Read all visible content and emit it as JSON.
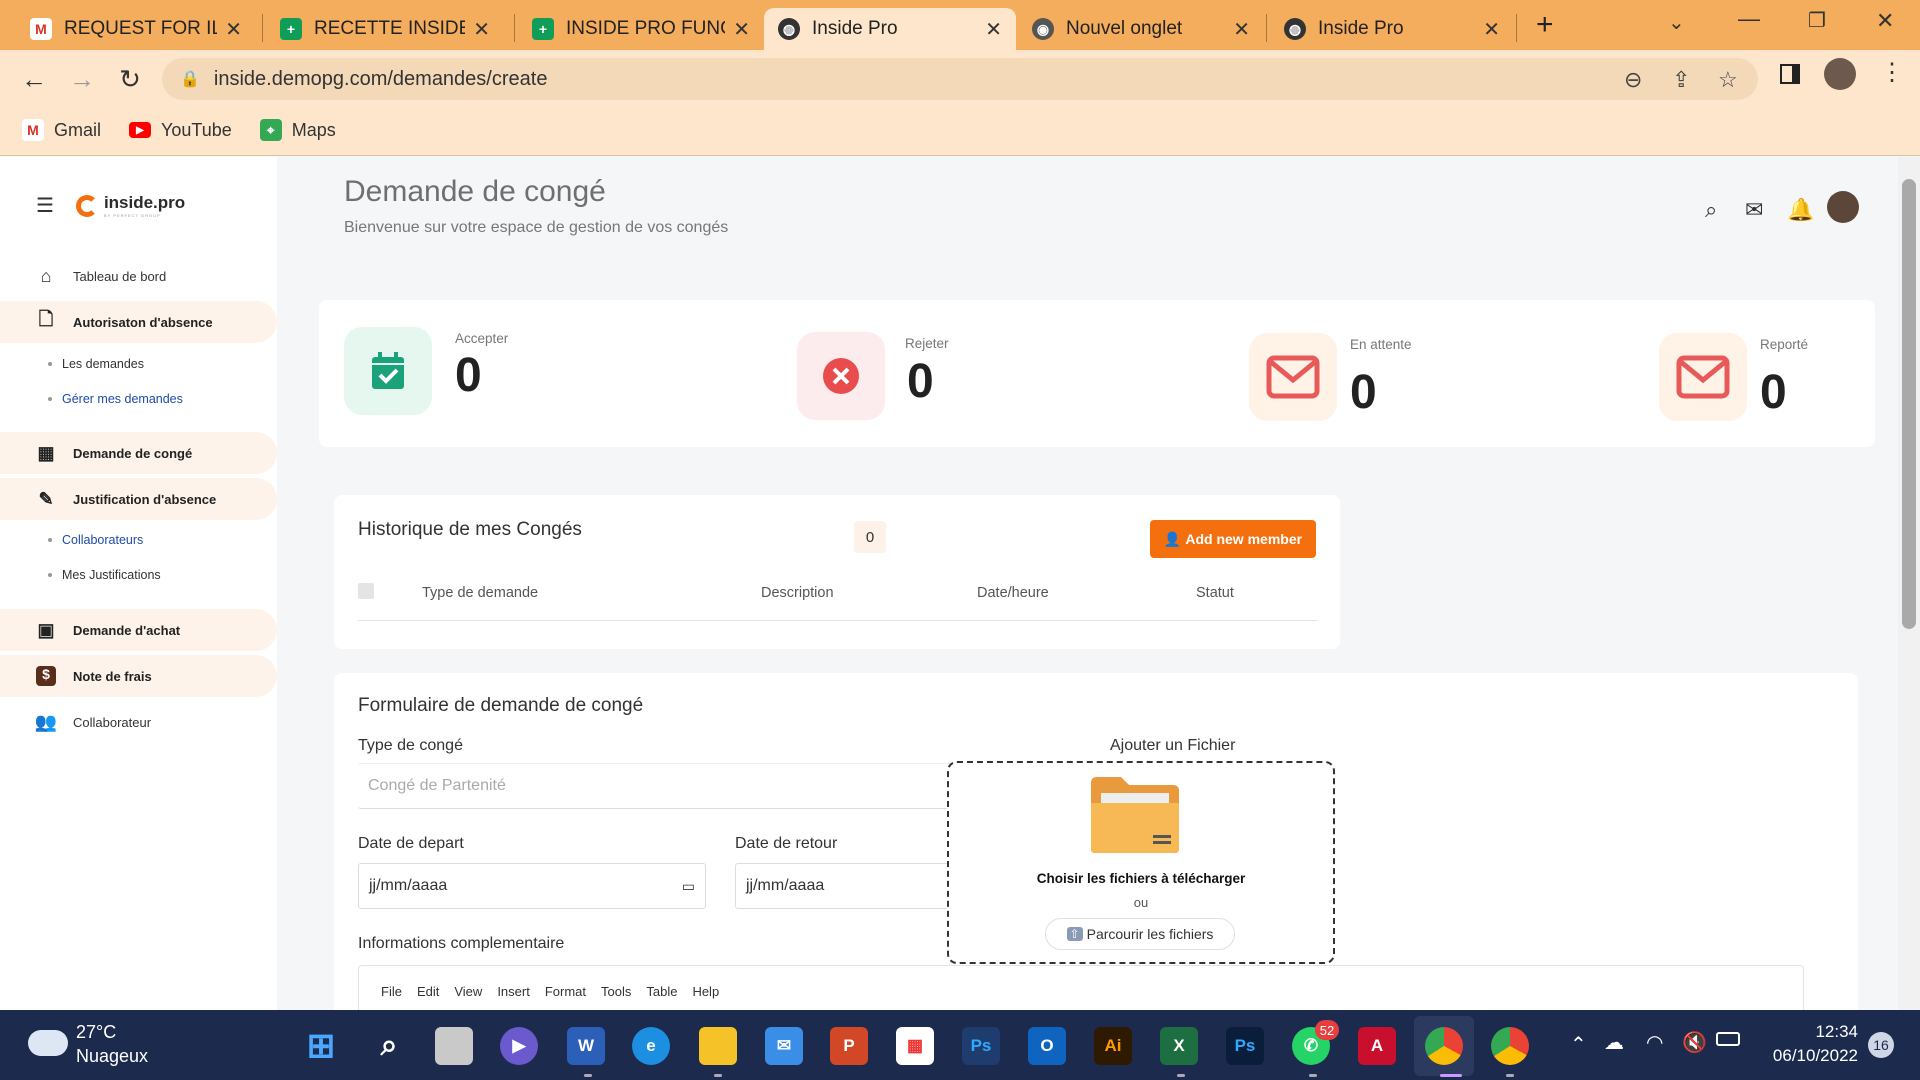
{
  "browser": {
    "tabs": [
      {
        "title": "REQUEST FOR ILLU",
        "icon": "gmail-icon"
      },
      {
        "title": "RECETTE INSIDE PR",
        "icon": "sheets-icon"
      },
      {
        "title": "INSIDE PRO FUNCT",
        "icon": "sheets-icon"
      },
      {
        "title": "Inside Pro",
        "icon": "globe-icon",
        "active": true
      },
      {
        "title": "Nouvel onglet",
        "icon": "chrome-icon"
      },
      {
        "title": "Inside Pro",
        "icon": "globe-icon"
      }
    ],
    "new_tab": "+",
    "url": "inside.demopg.com/demandes/create",
    "bookmarks": [
      {
        "label": "Gmail",
        "icon": "gmail-icon"
      },
      {
        "label": "YouTube",
        "icon": "youtube-icon"
      },
      {
        "label": "Maps",
        "icon": "maps-icon"
      }
    ]
  },
  "app": {
    "logo_text": "inside.pro",
    "logo_sub": "BY PERFECT GROUP",
    "sidebar": {
      "items": [
        {
          "label": "Tableau de bord",
          "icon": "home-icon"
        },
        {
          "label": "Autorisaton d'absence",
          "icon": "document-icon"
        },
        {
          "label": "Les demandes"
        },
        {
          "label": "Gérer mes demandes"
        },
        {
          "label": "Demande de congé",
          "icon": "calendar-icon"
        },
        {
          "label": "Justification d'absence",
          "icon": "edit-icon"
        },
        {
          "label": "Collaborateurs"
        },
        {
          "label": "Mes Justifications"
        },
        {
          "label": "Demande d'achat",
          "icon": "wallet-icon"
        },
        {
          "label": "Note de frais",
          "icon": "dollar-icon"
        },
        {
          "label": "Collaborateur",
          "icon": "users-icon"
        }
      ]
    },
    "header": {
      "title": "Demande de congé",
      "subtitle": "Bienvenue sur votre espace de gestion de vos congés"
    },
    "stats": [
      {
        "label": "Accepter",
        "value": "0",
        "color": "#1aa37a"
      },
      {
        "label": "Rejeter",
        "value": "0",
        "color": "#e84c4c"
      },
      {
        "label": "En attente",
        "value": "0",
        "color": "#e85a5a"
      },
      {
        "label": "Reporté",
        "value": "0",
        "color": "#e85a5a"
      }
    ],
    "history": {
      "title": "Historique de mes Congés",
      "count": "0",
      "add_button": "Add new member",
      "columns": [
        "Type de demande",
        "Description",
        "Date/heure",
        "Statut"
      ]
    },
    "form": {
      "title": "Formulaire de demande de congé",
      "type_label": "Type de congé",
      "type_placeholder": "Congé de Partenité",
      "depart_label": "Date de depart",
      "depart_value": "jj/mm/aaaa",
      "retour_label": "Date de retour",
      "retour_value": "jj/mm/aaaa",
      "info_label": "Informations complementaire",
      "editor_menu": [
        "File",
        "Edit",
        "View",
        "Insert",
        "Format",
        "Tools",
        "Table",
        "Help"
      ],
      "upload_label": "Ajouter un Fichier",
      "upload_title": "Choisir les fichiers à télécharger",
      "upload_or": "ou",
      "upload_button": "Parcourir les fichiers"
    }
  },
  "taskbar": {
    "weather_temp": "27°C",
    "weather_desc": "Nuageux",
    "whatsapp_badge": "52",
    "time": "12:34",
    "date": "06/10/2022",
    "notif_count": "16"
  },
  "colors": {
    "accent": "#f4700e",
    "tabbar": "#f4ad5c",
    "toolbar": "#fde6cb"
  }
}
